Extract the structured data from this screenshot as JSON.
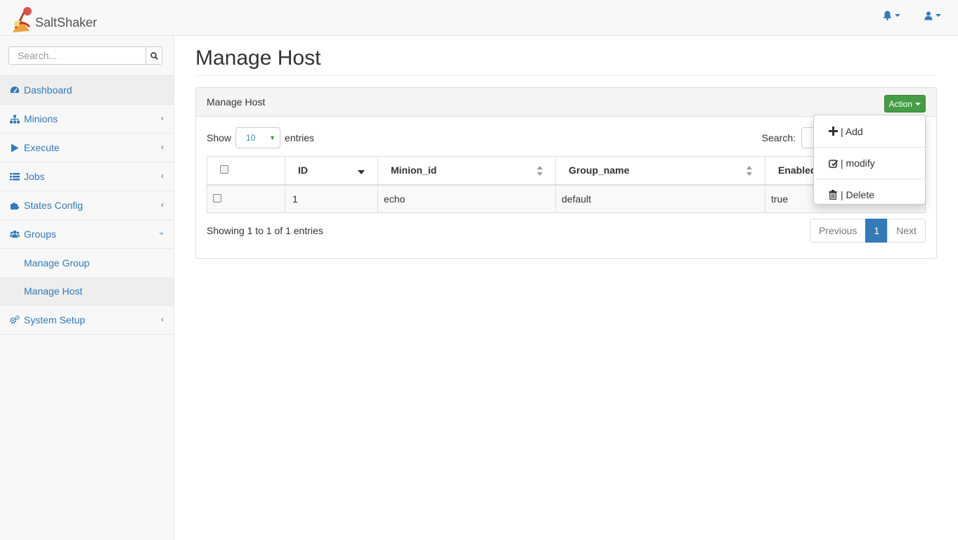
{
  "brand": {
    "name": "SaltShaker"
  },
  "topnav": {
    "icons": [
      "bell-icon",
      "user-icon"
    ]
  },
  "sidebar": {
    "search_placeholder": "Search...",
    "items": [
      {
        "label": "Dashboard",
        "icon": "dashboard-icon",
        "active": true
      },
      {
        "label": "Minions",
        "icon": "sitemap-icon"
      },
      {
        "label": "Execute",
        "icon": "play-icon"
      },
      {
        "label": "Jobs",
        "icon": "list-icon"
      },
      {
        "label": "States Config",
        "icon": "puzzle-icon"
      },
      {
        "label": "Groups",
        "icon": "users-icon",
        "expanded": true,
        "children": [
          {
            "label": "Manage Group"
          },
          {
            "label": "Manage Host",
            "active": true
          }
        ]
      },
      {
        "label": "System Setup",
        "icon": "gears-icon"
      }
    ]
  },
  "main": {
    "title": "Manage Host",
    "panel": {
      "heading": "Manage Host",
      "action_label": "Action",
      "show_label": "Show",
      "entries_label": "entries",
      "page_length": "10",
      "search_label": "Search:",
      "columns": [
        "ID",
        "Minion_id",
        "Group_name",
        "Enabled"
      ],
      "rows": [
        {
          "id": "1",
          "minion_id": "echo",
          "group_name": "default",
          "enabled": "true"
        }
      ],
      "info": "Showing 1 to 1 of 1 entries",
      "pagination": {
        "previous": "Previous",
        "current": "1",
        "next": "Next"
      }
    },
    "dropdown": {
      "items": [
        {
          "label": "| Add",
          "icon": "plus-icon"
        },
        {
          "label": "| modify",
          "icon": "edit-icon"
        },
        {
          "label": "| Delete",
          "icon": "trash-icon"
        }
      ]
    }
  },
  "colors": {
    "link": "#337ab7",
    "success": "#449d44",
    "active_page": "#337ab7"
  }
}
